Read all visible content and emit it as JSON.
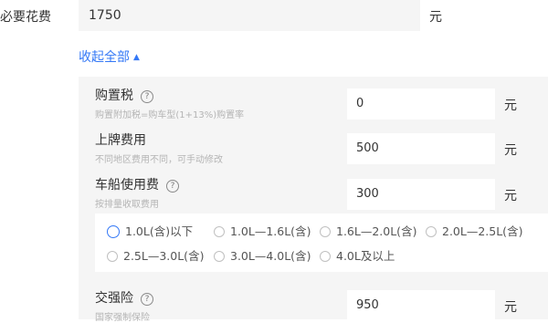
{
  "required_fee": {
    "label": "必要花费",
    "value": "1750",
    "unit": "元"
  },
  "collapse_toggle": {
    "label": "收起全部",
    "arrow": "▲"
  },
  "items": [
    {
      "title": "购置税",
      "help": "?",
      "sub": "购置附加税=购车型(1+13%)购置率",
      "value": "0",
      "unit": "元",
      "has_help": true
    },
    {
      "title": "上牌费用",
      "help": "",
      "sub": "不同地区费用不同，可手动修改",
      "value": "500",
      "unit": "元",
      "has_help": false
    },
    {
      "title": "车船使用费",
      "help": "?",
      "sub": "按排量收取费用",
      "value": "300",
      "unit": "元",
      "has_help": true
    },
    {
      "title": "交强险",
      "help": "?",
      "sub": "国家强制保险",
      "value": "950",
      "unit": "元",
      "has_help": true
    }
  ],
  "displacement_options": [
    {
      "label": "1.0L(含)以下",
      "selected": true
    },
    {
      "label": "1.0L—1.6L(含)",
      "selected": false
    },
    {
      "label": "1.6L—2.0L(含)",
      "selected": false
    },
    {
      "label": "2.0L—2.5L(含)",
      "selected": false
    },
    {
      "label": "2.5L—3.0L(含)",
      "selected": false
    },
    {
      "label": "3.0L—4.0L(含)",
      "selected": false
    },
    {
      "label": "4.0L及以上",
      "selected": false
    }
  ],
  "colors": {
    "accent": "#3478f6",
    "panel_bg": "#f5f5f5",
    "muted_text": "#b4b4b4"
  }
}
